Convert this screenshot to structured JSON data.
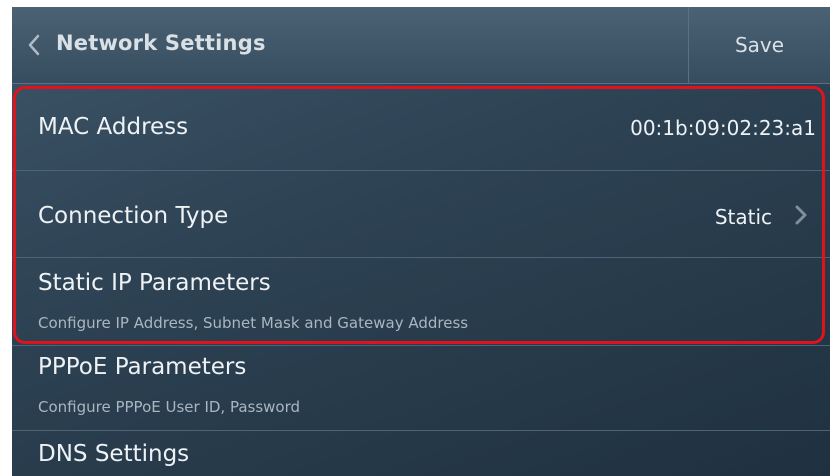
{
  "header": {
    "title": "Network Settings",
    "save_label": "Save",
    "back_icon": "chevron-left-icon"
  },
  "rows": {
    "mac": {
      "label": "MAC Address",
      "value": "00:1b:09:02:23:a1"
    },
    "connection": {
      "label": "Connection Type",
      "value": "Static",
      "icon": "chevron-right-icon"
    },
    "static_ip": {
      "label": "Static IP Parameters",
      "subtitle": "Configure IP Address, Subnet Mask and Gateway Address"
    },
    "pppoe": {
      "label": "PPPoE Parameters",
      "subtitle": "Configure PPPoE User ID, Password"
    },
    "dns": {
      "label": "DNS Settings"
    }
  },
  "colors": {
    "background": "#2c4152",
    "header": "#3f5769",
    "text": "#eef2f5",
    "subtext": "#aab6c0",
    "highlight": "#e0121b"
  }
}
